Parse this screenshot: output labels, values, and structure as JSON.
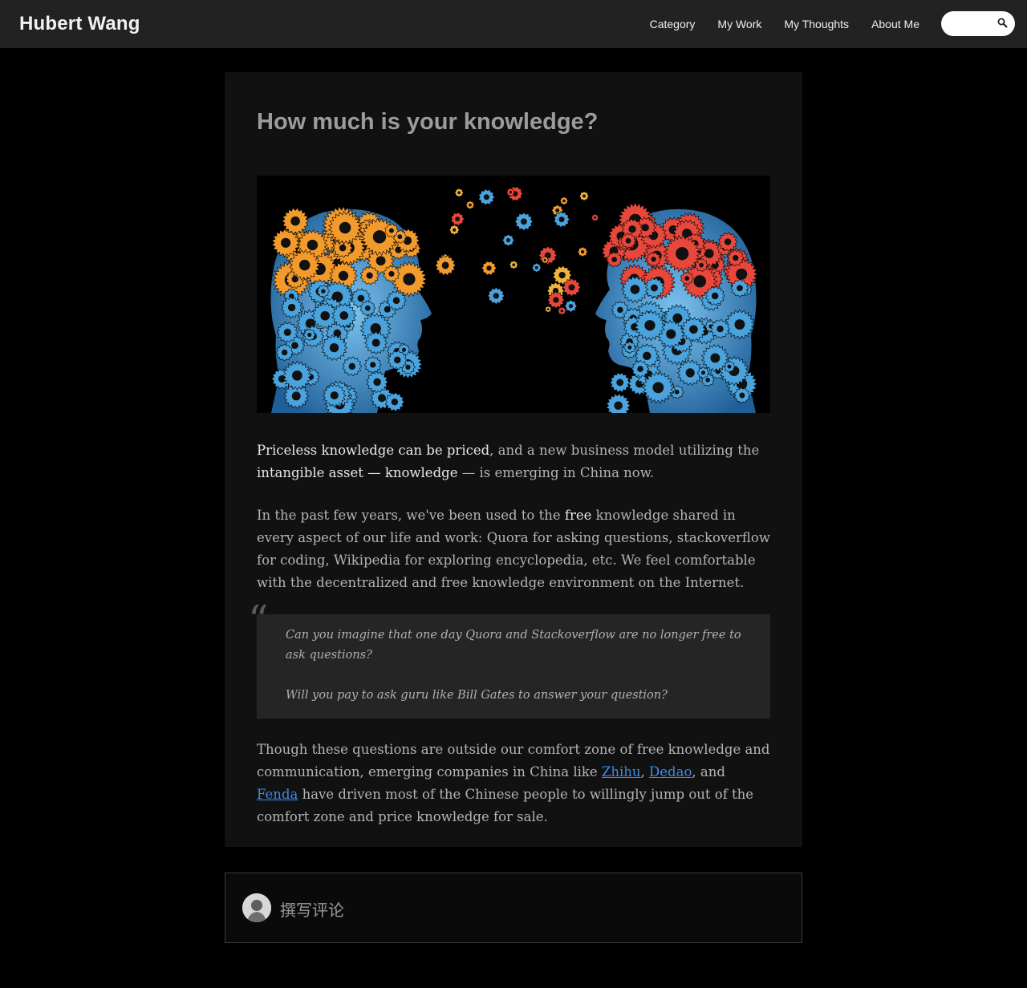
{
  "header": {
    "brand": "Hubert Wang",
    "nav": [
      "Category",
      "My Work",
      "My Thoughts",
      "About Me"
    ],
    "search": {
      "placeholder": "",
      "icon": "search-icon"
    }
  },
  "post": {
    "title": "How much is your knowledge?",
    "hero_image": {
      "subject": "two-heads-with-gears",
      "colors": {
        "left": "#f39a2c",
        "right": "#e8473b",
        "base": "#3a8bd1"
      }
    },
    "p1": {
      "bold1": "Priceless knowledge can be priced",
      "text1": ", and a new business model utilizing the ",
      "bold2": "intangible asset — knowledge",
      "text2": " — is emerging in China now."
    },
    "p2": {
      "text1": "In the past few years, we've been used to the ",
      "bold": "free",
      "text2": " knowledge shared in every aspect of our life and work: Quora for asking questions, stackoverflow for coding, Wikipedia for exploring encyclopedia, etc. We feel comfortable with the decentralized and free knowledge environment on the Internet."
    },
    "quote": {
      "mark": "“",
      "line1": "Can you imagine that one day Quora and Stackoverflow are no longer free to ask questions?",
      "line2": "Will you pay to ask guru like Bill Gates to answer your question?"
    },
    "p3": {
      "text1": "Though these questions are outside our comfort zone of free knowledge and communication, emerging companies in China like ",
      "link1": "Zhihu",
      "sep1": ", ",
      "link2": "Dedao",
      "sep2": ", and ",
      "link3": "Fenda",
      "text2": " have driven most of the Chinese people to willingly jump out of the comfort zone and price knowledge for sale."
    }
  },
  "comment": {
    "label": "撰写评论",
    "avatar_icon": "user-avatar"
  },
  "colors": {
    "link": "#3f8ae6",
    "background": "#000000",
    "card": "#111111",
    "topbar": "#222222"
  }
}
